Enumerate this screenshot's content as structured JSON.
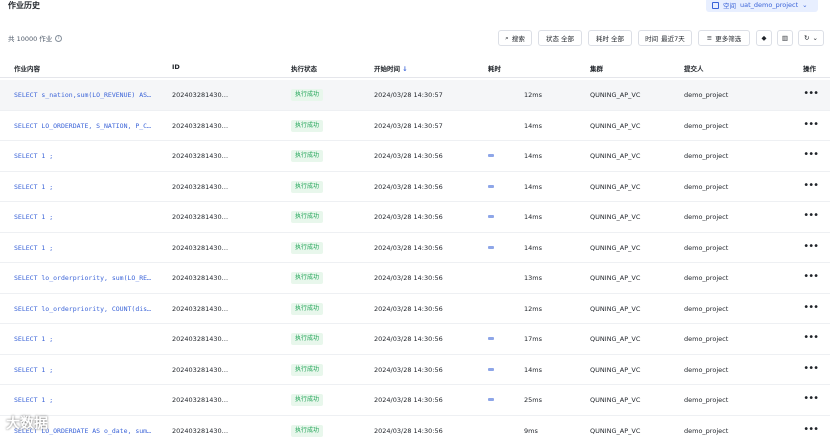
{
  "header": {
    "title": "作业历史",
    "workspace_label": "空间",
    "workspace_value": "uat_demo_project"
  },
  "toolbar": {
    "count_label": "共 10000 作业",
    "search": "搜索",
    "status": "状态 全部",
    "duration": "耗时 全部",
    "time_prefix": "时间",
    "time_value": "最近7天",
    "more_filters": "更多筛选"
  },
  "table": {
    "columns": [
      "作业内容",
      "ID",
      "执行状态",
      "开始时间",
      "耗时",
      "集群",
      "提交人",
      "操作"
    ],
    "rows": [
      {
        "sql": "SELECT s_nation,sum(LO_REVENUE) AS…",
        "id": "202403281430…",
        "status": "执行成功",
        "start": "2024/03/28 14:30:57",
        "duration": "12ms",
        "cluster": "QUNING_AP_VC",
        "submitter": "demo_project"
      },
      {
        "sql": "SELECT LO_ORDERDATE, S_NATION, P_C…",
        "id": "202403281430…",
        "status": "执行成功",
        "start": "2024/03/28 14:30:57",
        "duration": "14ms",
        "cluster": "QUNING_AP_VC",
        "submitter": "demo_project"
      },
      {
        "sql": "SELECT 1 ;",
        "id": "202403281430…",
        "status": "执行成功",
        "start": "2024/03/28 14:30:56",
        "duration": "14ms",
        "cluster": "QUNING_AP_VC",
        "submitter": "demo_project"
      },
      {
        "sql": "SELECT 1 ;",
        "id": "202403281430…",
        "status": "执行成功",
        "start": "2024/03/28 14:30:56",
        "duration": "14ms",
        "cluster": "QUNING_AP_VC",
        "submitter": "demo_project"
      },
      {
        "sql": "SELECT 1 ;",
        "id": "202403281430…",
        "status": "执行成功",
        "start": "2024/03/28 14:30:56",
        "duration": "14ms",
        "cluster": "QUNING_AP_VC",
        "submitter": "demo_project"
      },
      {
        "sql": "SELECT 1 ;",
        "id": "202403281430…",
        "status": "执行成功",
        "start": "2024/03/28 14:30:56",
        "duration": "14ms",
        "cluster": "QUNING_AP_VC",
        "submitter": "demo_project"
      },
      {
        "sql": "SELECT lo_orderpriority, sum(LO_RE…",
        "id": "202403281430…",
        "status": "执行成功",
        "start": "2024/03/28 14:30:56",
        "duration": "13ms",
        "cluster": "QUNING_AP_VC",
        "submitter": "demo_project"
      },
      {
        "sql": "SELECT lo_orderpriority, COUNT(dis…",
        "id": "202403281430…",
        "status": "执行成功",
        "start": "2024/03/28 14:30:56",
        "duration": "12ms",
        "cluster": "QUNING_AP_VC",
        "submitter": "demo_project"
      },
      {
        "sql": "SELECT 1 ;",
        "id": "202403281430…",
        "status": "执行成功",
        "start": "2024/03/28 14:30:56",
        "duration": "17ms",
        "cluster": "QUNING_AP_VC",
        "submitter": "demo_project"
      },
      {
        "sql": "SELECT 1 ;",
        "id": "202403281430…",
        "status": "执行成功",
        "start": "2024/03/28 14:30:56",
        "duration": "14ms",
        "cluster": "QUNING_AP_VC",
        "submitter": "demo_project"
      },
      {
        "sql": "SELECT 1 ;",
        "id": "202403281430…",
        "status": "执行成功",
        "start": "2024/03/28 14:30:56",
        "duration": "25ms",
        "cluster": "QUNING_AP_VC",
        "submitter": "demo_project"
      },
      {
        "sql": "SELECT LO_ORDERDATE AS o_date, sum…",
        "id": "202403281430…",
        "status": "执行成功",
        "start": "2024/03/28 14:30:56",
        "duration": "9ms",
        "cluster": "QUNING_AP_VC",
        "submitter": "demo_project"
      }
    ]
  },
  "colors": {
    "accent": "#3a63d8",
    "success_bg": "#e8f7ec",
    "success_text": "#23a559"
  },
  "watermark": "大数据"
}
